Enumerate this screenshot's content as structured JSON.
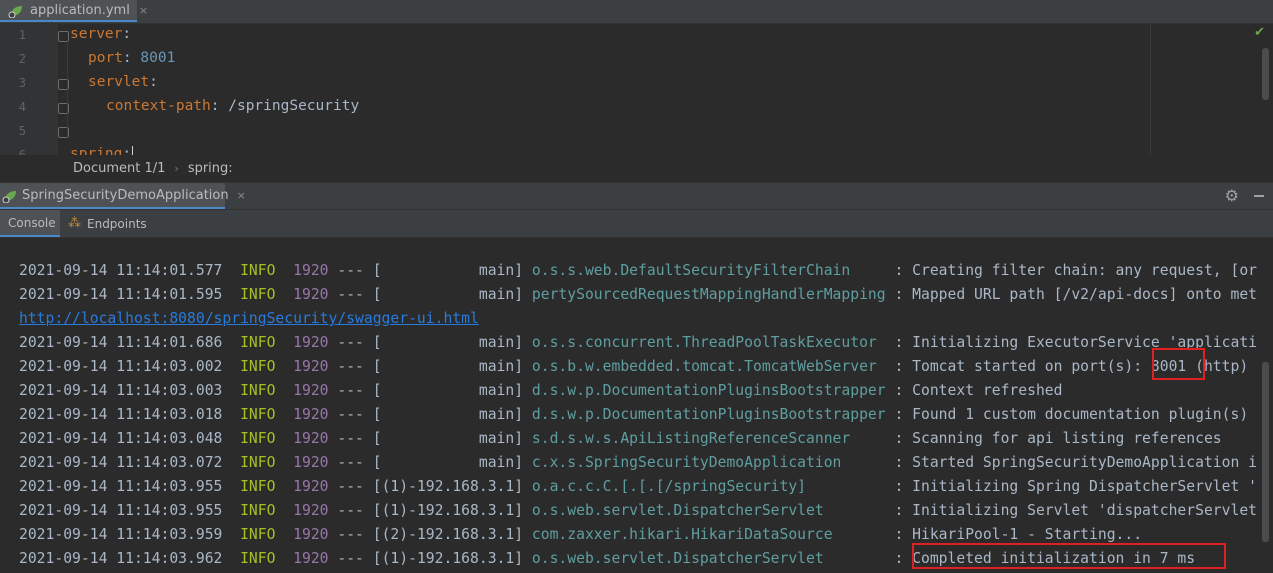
{
  "editor_tab": {
    "filename": "application.yml",
    "close": "×"
  },
  "editor": {
    "line_numbers": [
      "1",
      "2",
      "3",
      "4",
      "5",
      "6"
    ],
    "lines": [
      {
        "key": "server",
        "colon": ":",
        "value": ""
      },
      {
        "key": "port",
        "colon": ":",
        "value": " 8001"
      },
      {
        "key": "servlet",
        "colon": ":",
        "value": ""
      },
      {
        "key": "context-path",
        "colon": ":",
        "value": " /springSecurity"
      },
      {
        "key": "",
        "colon": "",
        "value": ""
      },
      {
        "key": "spring",
        "colon": ":",
        "value": ""
      }
    ],
    "status_check": "✔"
  },
  "breadcrumb": {
    "doc": "Document 1/1",
    "sep": "›",
    "node": "spring:"
  },
  "run_window": {
    "tab_label": "SpringSecurityDemoApplication",
    "close": "×",
    "gear": "⚙",
    "sub_tabs": {
      "console": "Console",
      "endpoints": "Endpoints"
    }
  },
  "console": {
    "rows": [
      {
        "date": "2021-09-14 11:14:01.577",
        "level": "INFO",
        "pid": "1920",
        "sep": " --- [",
        "thread": "           main]",
        "logger": "o.s.s.web.DefaultSecurityFilterChain    ",
        "msg": " : Creating filter chain: any request, [or"
      },
      {
        "date": "2021-09-14 11:14:01.595",
        "level": "INFO",
        "pid": "1920",
        "sep": " --- [",
        "thread": "           main]",
        "logger": "pertySourcedRequestMappingHandlerMapping",
        "msg": " : Mapped URL path [/v2/api-docs] onto met"
      },
      {
        "link": "http://localhost:8080/springSecurity/swagger-ui.html"
      },
      {
        "date": "2021-09-14 11:14:01.686",
        "level": "INFO",
        "pid": "1920",
        "sep": " --- [",
        "thread": "           main]",
        "logger": "o.s.s.concurrent.ThreadPoolTaskExecutor ",
        "msg": " : Initializing ExecutorService 'applicati"
      },
      {
        "date": "2021-09-14 11:14:03.002",
        "level": "INFO",
        "pid": "1920",
        "sep": " --- [",
        "thread": "           main]",
        "logger": "o.s.b.w.embedded.tomcat.TomcatWebServer ",
        "msg": " : Tomcat started on port(s): 8001 (http)"
      },
      {
        "date": "2021-09-14 11:14:03.003",
        "level": "INFO",
        "pid": "1920",
        "sep": " --- [",
        "thread": "           main]",
        "logger": "d.s.w.p.DocumentationPluginsBootstrapper",
        "msg": " : Context refreshed"
      },
      {
        "date": "2021-09-14 11:14:03.018",
        "level": "INFO",
        "pid": "1920",
        "sep": " --- [",
        "thread": "           main]",
        "logger": "d.s.w.p.DocumentationPluginsBootstrapper",
        "msg": " : Found 1 custom documentation plugin(s)"
      },
      {
        "date": "2021-09-14 11:14:03.048",
        "level": "INFO",
        "pid": "1920",
        "sep": " --- [",
        "thread": "           main]",
        "logger": "s.d.s.w.s.ApiListingReferenceScanner    ",
        "msg": " : Scanning for api listing references"
      },
      {
        "date": "2021-09-14 11:14:03.072",
        "level": "INFO",
        "pid": "1920",
        "sep": " --- [",
        "thread": "           main]",
        "logger": "c.x.s.SpringSecurityDemoApplication     ",
        "msg": " : Started SpringSecurityDemoApplication i"
      },
      {
        "date": "2021-09-14 11:14:03.955",
        "level": "INFO",
        "pid": "1920",
        "sep": " --- [",
        "thread": "(1)-192.168.3.1]",
        "logger": "o.a.c.c.C.[.[.[/springSecurity]         ",
        "msg": " : Initializing Spring DispatcherServlet '"
      },
      {
        "date": "2021-09-14 11:14:03.955",
        "level": "INFO",
        "pid": "1920",
        "sep": " --- [",
        "thread": "(1)-192.168.3.1]",
        "logger": "o.s.web.servlet.DispatcherServlet       ",
        "msg": " : Initializing Servlet 'dispatcherServlet"
      },
      {
        "date": "2021-09-14 11:14:03.959",
        "level": "INFO",
        "pid": "1920",
        "sep": " --- [",
        "thread": "(2)-192.168.3.1]",
        "logger": "com.zaxxer.hikari.HikariDataSource      ",
        "msg": " : HikariPool-1 - Starting..."
      },
      {
        "date": "2021-09-14 11:14:03.962",
        "level": "INFO",
        "pid": "1920",
        "sep": " --- [",
        "thread": "(1)-192.168.3.1]",
        "logger": "o.s.web.servlet.DispatcherServlet       ",
        "msg": " : Completed initialization in 7 ms"
      }
    ]
  },
  "colors": {
    "highlight_box": "#e02020",
    "accent_tab": "#4a88c7",
    "info_level": "#a8c023"
  }
}
